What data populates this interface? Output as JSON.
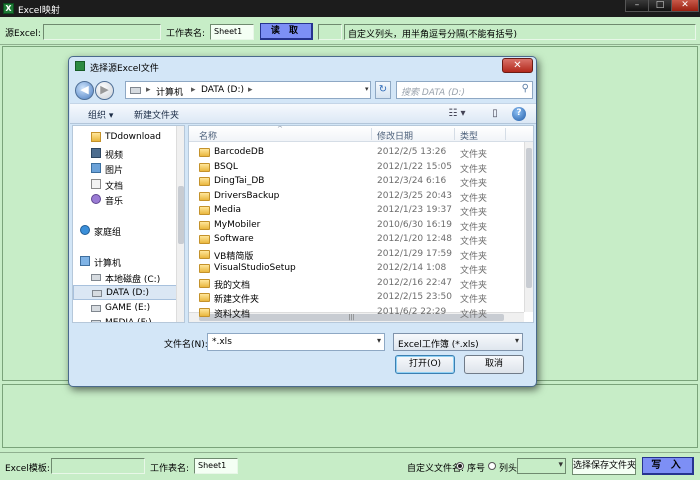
{
  "window": {
    "title": "Excel映射",
    "app_icon": "excel-icon",
    "min_glyph": "–",
    "max_glyph": "□",
    "close_glyph": "✕"
  },
  "top_toolbar": {
    "source_label": "源Excel:",
    "source_value": "",
    "sheet_label": "工作表名:",
    "sheet_value": "Sheet1",
    "read_button": "读 取",
    "column_hint": "自定义列头，用半角逗号分隔(不能有括号)"
  },
  "bottom_bar": {
    "template_label": "Excel模板:",
    "template_value": "",
    "sheet_label": "工作表名:",
    "sheet_value": "Sheet1",
    "custom_filename_label": "自定义文件名:",
    "radio_seq_label": "序号",
    "radio_col_label": "列头",
    "radio_selected": "序号",
    "combo_value": "",
    "save_folder_button": "选择保存文件夹",
    "write_button": "写 入"
  },
  "dialog": {
    "title": "选择源Excel文件",
    "back_glyph": "◀",
    "fwd_glyph": "▶",
    "dropdown_glyph": "▾",
    "address_segments": [
      "计算机",
      "DATA (D:)"
    ],
    "address_sep": "▸",
    "refresh_glyph": "↻",
    "search_placeholder": "搜索 DATA (D:)",
    "search_glyph": "⚲",
    "organize_label": "组织 ▾",
    "new_folder_label": "新建文件夹",
    "view_glyph": "☷ ▾",
    "pane_glyph": "▯",
    "help_glyph": "?",
    "tree": [
      {
        "label": "TDdownload",
        "icon": "folder-icon",
        "indent": 1
      },
      {
        "label": "视频",
        "icon": "video-library-icon",
        "indent": 1
      },
      {
        "label": "图片",
        "icon": "pictures-library-icon",
        "indent": 1
      },
      {
        "label": "文档",
        "icon": "documents-library-icon",
        "indent": 1
      },
      {
        "label": "音乐",
        "icon": "music-library-icon",
        "indent": 1
      },
      {
        "label": "",
        "icon": "",
        "indent": 0
      },
      {
        "label": "家庭组",
        "icon": "homegroup-icon",
        "indent": 0
      },
      {
        "label": "",
        "icon": "",
        "indent": 0
      },
      {
        "label": "计算机",
        "icon": "computer-icon",
        "indent": 0
      },
      {
        "label": "本地磁盘 (C:)",
        "icon": "drive-icon",
        "indent": 1
      },
      {
        "label": "DATA (D:)",
        "icon": "drive-icon",
        "indent": 1,
        "selected": true
      },
      {
        "label": "GAME (E:)",
        "icon": "drive-icon",
        "indent": 1
      },
      {
        "label": "MEDIA (F:)",
        "icon": "drive-icon",
        "indent": 1
      }
    ],
    "columns": {
      "name": "名称",
      "modified": "修改日期",
      "type": "类型",
      "sort_glyph": "^"
    },
    "files": [
      {
        "name": "BarcodeDB",
        "modified": "2012/2/5 13:26",
        "type": "文件夹"
      },
      {
        "name": "BSQL",
        "modified": "2012/1/22 15:05",
        "type": "文件夹"
      },
      {
        "name": "DingTai_DB",
        "modified": "2012/3/24 6:16",
        "type": "文件夹"
      },
      {
        "name": "DriversBackup",
        "modified": "2012/3/25 20:43",
        "type": "文件夹"
      },
      {
        "name": "Media",
        "modified": "2012/1/23 19:37",
        "type": "文件夹"
      },
      {
        "name": "MyMobiler",
        "modified": "2010/6/30 16:19",
        "type": "文件夹"
      },
      {
        "name": "Software",
        "modified": "2012/1/20 12:48",
        "type": "文件夹"
      },
      {
        "name": "VB精简版",
        "modified": "2012/1/29 17:59",
        "type": "文件夹"
      },
      {
        "name": "VisualStudioSetup",
        "modified": "2012/2/14 1:08",
        "type": "文件夹"
      },
      {
        "name": "我的文档",
        "modified": "2012/2/16 22:47",
        "type": "文件夹"
      },
      {
        "name": "新建文件夹",
        "modified": "2012/2/15 23:50",
        "type": "文件夹"
      },
      {
        "name": "资料文档",
        "modified": "2011/6/2 22:29",
        "type": "文件夹"
      }
    ],
    "filename_label": "文件名(N):",
    "filename_value": "*.xls",
    "filetype_value": "Excel工作簿 (*.xls)",
    "open_button": "打开(O)",
    "cancel_button": "取消",
    "close_glyph": "✕",
    "hscroll_glyph": "|||"
  },
  "colors": {
    "app_bg": "#c7edc7",
    "button_blue": "#7d8ff5",
    "dialog_bg": "#d3e6f7"
  }
}
